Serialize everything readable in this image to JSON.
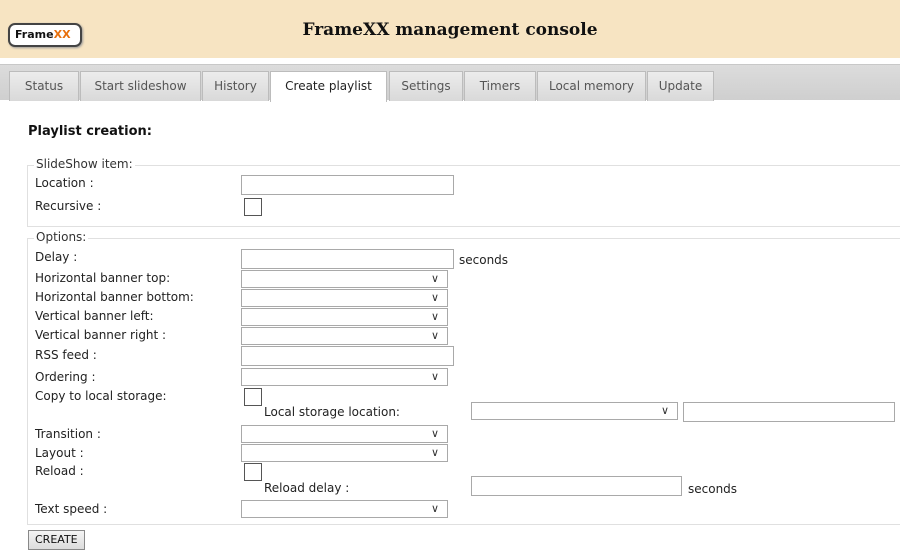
{
  "header": {
    "logo_prefix": "Frame",
    "logo_suffix": "XX",
    "title": "FrameXX management console"
  },
  "tabs": [
    {
      "label": "Status"
    },
    {
      "label": "Start slideshow"
    },
    {
      "label": "History"
    },
    {
      "label": "Create playlist"
    },
    {
      "label": "Settings"
    },
    {
      "label": "Timers"
    },
    {
      "label": "Local memory"
    },
    {
      "label": "Update"
    }
  ],
  "active_tab": "Create playlist",
  "page": {
    "heading": "Playlist creation:"
  },
  "slideshow_item": {
    "legend": "SlideShow item:",
    "location_label": "Location :",
    "location_value": "",
    "recursive_label": "Recursive :",
    "recursive_checked": false
  },
  "options": {
    "legend": "Options:",
    "delay_label": "Delay :",
    "delay_value": "",
    "delay_unit": "seconds",
    "h_banner_top_label": "Horizontal banner top:",
    "h_banner_bottom_label": "Horizontal banner bottom:",
    "v_banner_left_label": "Vertical banner left:",
    "v_banner_right_label": "Vertical banner right :",
    "rss_label": "RSS feed :",
    "rss_value": "",
    "ordering_label": "Ordering :",
    "copy_label": "Copy to local storage:",
    "copy_checked": false,
    "local_storage_location_label": "Local storage location:",
    "local_storage_value": "",
    "transition_label": "Transition :",
    "layout_label": "Layout :",
    "reload_label": "Reload :",
    "reload_checked": false,
    "reload_delay_label": "Reload delay :",
    "reload_delay_value": "",
    "reload_delay_unit": "seconds",
    "text_speed_label": "Text speed :"
  },
  "create_button": "CREATE",
  "icons": {
    "dropdown": "chevron-down-icon",
    "chevron_glyph": "∨"
  }
}
